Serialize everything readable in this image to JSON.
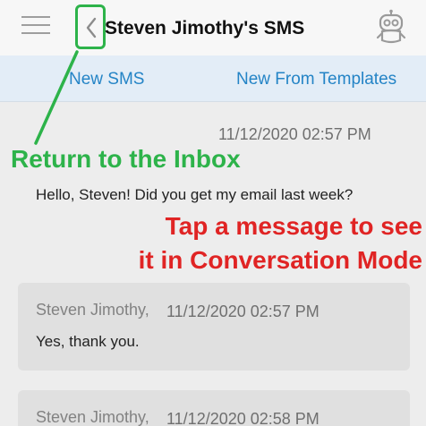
{
  "header": {
    "title": "Steven Jimothy's SMS",
    "menu_icon": "menu-icon",
    "back_icon": "chevron-left-icon",
    "profile_icon": "robot-icon"
  },
  "actions": {
    "new_sms": "New SMS",
    "new_from_templates": "New From Templates"
  },
  "messages": [
    {
      "direction": "incoming",
      "timestamp": "11/12/2020 02:57 PM",
      "body": "Hello, Steven! Did you get my email last week?"
    },
    {
      "direction": "outgoing",
      "sender": "Steven Jimothy,",
      "timestamp": "11/12/2020 02:57 PM",
      "body": "Yes, thank you."
    },
    {
      "direction": "outgoing",
      "sender": "Steven Jimothy,",
      "timestamp": "11/12/2020 02:58 PM",
      "body": ""
    }
  ],
  "annotations": {
    "return": "Return to the Inbox",
    "tap_line1": "Tap a message to see",
    "tap_line2": "it in Conversation Mode"
  },
  "colors": {
    "accent_green": "#2db34a",
    "annotation_red": "#e02424",
    "link_blue": "#2484c6",
    "action_bar_bg": "#e3edf7",
    "bubble_bg": "#e0e0e0"
  }
}
